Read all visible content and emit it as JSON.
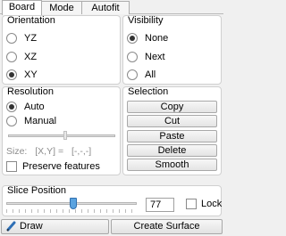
{
  "tabs": [
    "Board",
    "Mode",
    "Autofit"
  ],
  "orientation": {
    "title": "Orientation",
    "options": [
      "YZ",
      "XZ",
      "XY"
    ],
    "selected": "XY"
  },
  "visibility": {
    "title": "Visibility",
    "options": [
      "None",
      "Next",
      "All"
    ],
    "selected": "None"
  },
  "resolution": {
    "title": "Resolution",
    "options": [
      "Auto",
      "Manual"
    ],
    "selected": "Auto",
    "size_label": "Size:",
    "size_coords": "[X,Y] =",
    "size_value": "[-,-,-]",
    "preserve_label": "Preserve features"
  },
  "selection": {
    "title": "Selection",
    "buttons": [
      "Copy",
      "Cut",
      "Paste",
      "Delete",
      "Smooth"
    ]
  },
  "slice": {
    "title": "Slice Position",
    "value": "77",
    "lock_label": "Lock"
  },
  "bottom": {
    "draw_label": "Draw",
    "create_label": "Create Surface"
  }
}
